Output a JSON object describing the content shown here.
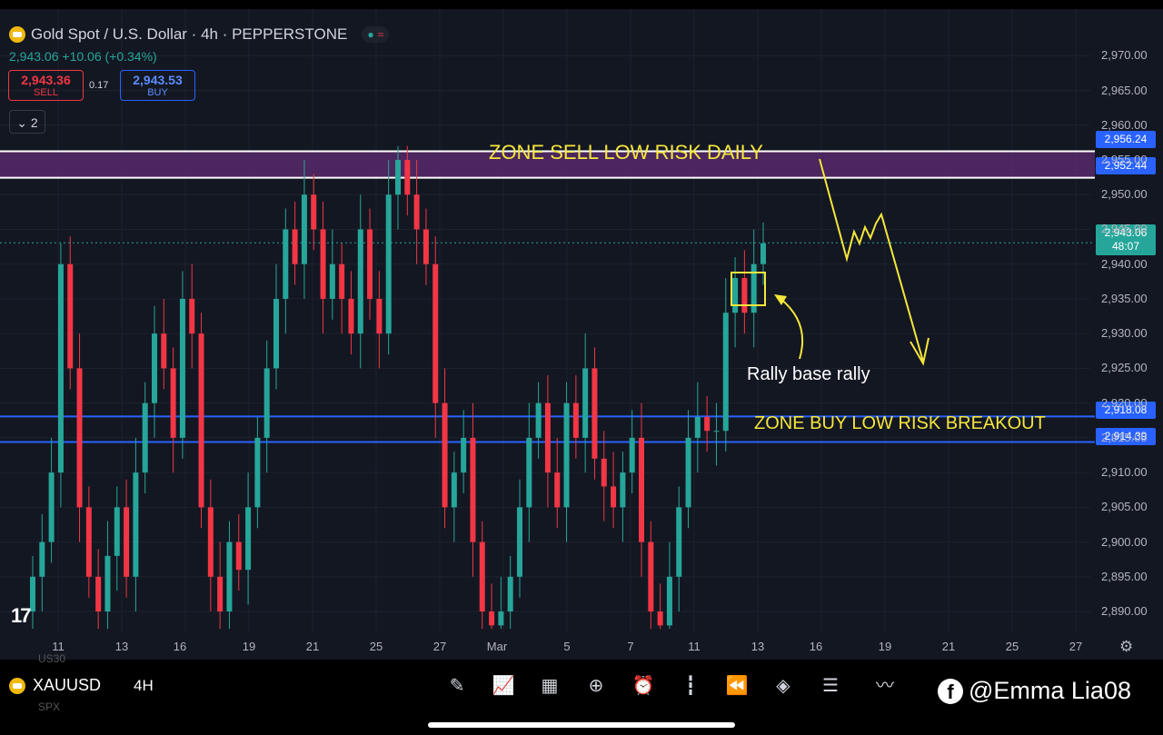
{
  "header": {
    "title": "Gold Spot / U.S. Dollar · 4h · PEPPERSTONE",
    "last_price": "2,943.06",
    "change": "+10.06 (+0.34%)",
    "sell_price": "2,943.36",
    "sell_label": "SELL",
    "spread": "0.17",
    "buy_price": "2,943.53",
    "buy_label": "BUY",
    "indicators_count": "2",
    "collapse_icon": "chevron-down-icon"
  },
  "annotations": {
    "sell_zone": "ZONE SELL LOW RISK DAILY",
    "buy_zone": "ZONE BUY LOW RISK BREAKOUT",
    "pattern": "Rally base rally"
  },
  "price_labels": {
    "zone_top": "2,956.24",
    "zone_bottom": "2,952.44",
    "current": "2,943.06",
    "countdown": "48:07",
    "buy_top": "2,918.08",
    "buy_bottom": "2,914.39"
  },
  "y_axis": [
    "2,970.00",
    "2,965.00",
    "2,960.00",
    "2,955.00",
    "2,950.00",
    "2,945.00",
    "2,940.00",
    "2,935.00",
    "2,930.00",
    "2,925.00",
    "2,920.00",
    "2,915.00",
    "2,910.00",
    "2,905.00",
    "2,900.00",
    "2,895.00",
    "2,890.00"
  ],
  "x_axis": [
    "11",
    "13",
    "16",
    "19",
    "21",
    "25",
    "27",
    "Mar",
    "5",
    "7",
    "11",
    "13",
    "16",
    "19",
    "21",
    "25",
    "27"
  ],
  "bottom_bar": {
    "symbol": "XAUUSD",
    "timeframe": "4H",
    "ghost_top": "US30",
    "ghost_bottom": "SPX",
    "watermark": "@Emma Lia08",
    "tools": [
      "pencil-icon",
      "indicators-icon",
      "grid-icon",
      "add-icon",
      "alarm-icon",
      "candles-icon",
      "replay-icon",
      "layers-icon",
      "settings-sliders-icon",
      "trend-icon",
      "undo-icon",
      "snapshot-icon",
      "redo-icon",
      "plus-circle-icon",
      "share-icon"
    ]
  },
  "colors": {
    "background": "#131722",
    "bull": "#26a69a",
    "bear": "#f23645",
    "zone_sell": "#5b2a6e",
    "zone_line_buy": "#2962ff",
    "annotation": "#f5e63b"
  },
  "chart_data": {
    "type": "candlestick",
    "symbol": "XAUUSD",
    "timeframe": "4h",
    "y_range": [
      2887,
      2972
    ],
    "sell_zone": [
      2952.44,
      2956.24
    ],
    "buy_zone": [
      2914.39,
      2918.08
    ],
    "current_price": 2943.06,
    "closes": [
      2895,
      2900,
      2910,
      2940,
      2925,
      2905,
      2895,
      2890,
      2898,
      2905,
      2895,
      2910,
      2920,
      2930,
      2925,
      2915,
      2935,
      2930,
      2905,
      2895,
      2890,
      2900,
      2896,
      2905,
      2915,
      2925,
      2935,
      2945,
      2940,
      2950,
      2945,
      2935,
      2940,
      2935,
      2930,
      2945,
      2935,
      2930,
      2950,
      2955,
      2950,
      2945,
      2940,
      2920,
      2905,
      2910,
      2915,
      2900,
      2890,
      2888,
      2890,
      2895,
      2905,
      2915,
      2920,
      2910,
      2905,
      2920,
      2915,
      2925,
      2912,
      2908,
      2905,
      2910,
      2915,
      2900,
      2890,
      2888,
      2895,
      2905,
      2915,
      2918,
      2916,
      2916,
      2933,
      2938,
      2933,
      2940,
      2943
    ]
  }
}
